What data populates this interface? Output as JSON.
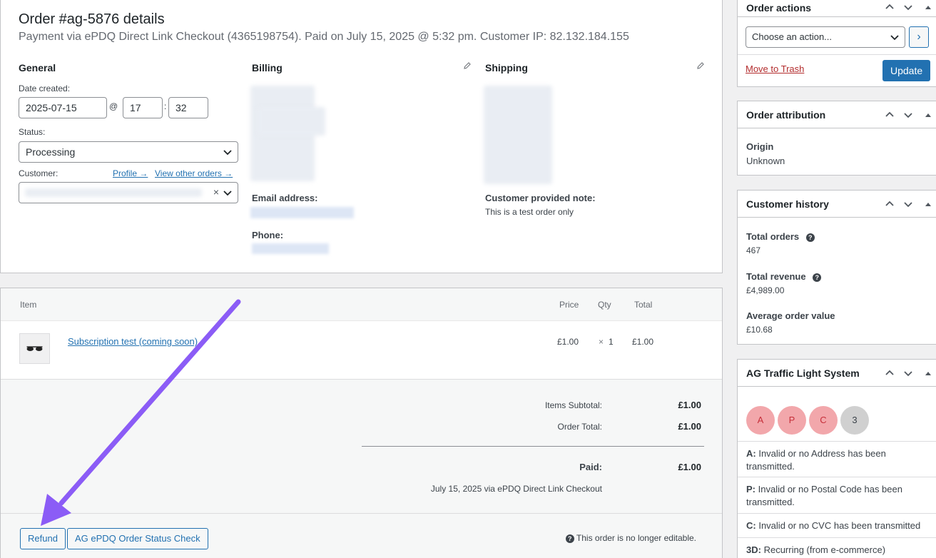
{
  "order": {
    "title": "Order #ag-5876 details",
    "subtitle": "Payment via ePDQ Direct Link Checkout (4365198754). Paid on July 15, 2025 @ 5:32 pm. Customer IP: 82.132.184.155"
  },
  "general": {
    "heading": "General",
    "date_label": "Date created:",
    "date_value": "2025-07-15",
    "at_sign": "@",
    "hour_value": "17",
    "colon": ":",
    "minute_value": "32",
    "status_label": "Status:",
    "status_value": "Processing",
    "customer_label": "Customer:",
    "profile_link": "Profile →",
    "other_orders_link": "View other orders →",
    "clear_glyph": "×"
  },
  "billing": {
    "heading": "Billing",
    "email_label": "Email address:",
    "phone_label": "Phone:"
  },
  "shipping": {
    "heading": "Shipping",
    "note_label": "Customer provided note:",
    "note_value": "This is a test order only"
  },
  "items": {
    "headers": {
      "item": "Item",
      "price": "Price",
      "qty": "Qty",
      "total": "Total"
    },
    "rows": [
      {
        "name": "Subscription test (coming soon)",
        "price": "£1.00",
        "qty_prefix": "×",
        "qty": "1",
        "total": "£1.00"
      }
    ],
    "totals": {
      "subtotal_label": "Items Subtotal:",
      "subtotal_value": "£1.00",
      "order_total_label": "Order Total:",
      "order_total_value": "£1.00",
      "paid_label": "Paid:",
      "paid_value": "£1.00",
      "paid_note": "July 15, 2025 via ePDQ Direct Link Checkout"
    },
    "refund_button": "Refund",
    "status_check_button": "AG ePDQ Order Status Check",
    "not_editable": "This order is no longer editable.",
    "help_glyph": "?"
  },
  "order_actions": {
    "title": "Order actions",
    "select_value": "Choose an action...",
    "go_glyph": "›",
    "trash_link": "Move to Trash",
    "update_button": "Update"
  },
  "attribution": {
    "title": "Order attribution",
    "origin_label": "Origin",
    "origin_value": "Unknown"
  },
  "history": {
    "title": "Customer history",
    "total_orders_label": "Total orders",
    "total_orders_value": "467",
    "total_revenue_label": "Total revenue",
    "total_revenue_value": "£4,989.00",
    "aov_label": "Average order value",
    "aov_value": "£10.68",
    "help_glyph": "?"
  },
  "traffic": {
    "title": "AG Traffic Light System",
    "circles": [
      "A",
      "P",
      "C",
      "3"
    ],
    "legend": [
      {
        "key": "A:",
        "text": "Invalid or no Address has been transmitted."
      },
      {
        "key": "P:",
        "text": "Invalid or no Postal Code has been transmitted."
      },
      {
        "key": "C:",
        "text": "Invalid or no CVC has been transmitted"
      },
      {
        "key": "3D:",
        "text": "Recurring (from e-commerce)"
      }
    ]
  },
  "colors": {
    "accent": "#2271b1",
    "danger": "#b32d2e",
    "circle_red": "#f2a7ab",
    "circle_grey": "#d0d0d0",
    "arrow": "#8b5cf6"
  }
}
